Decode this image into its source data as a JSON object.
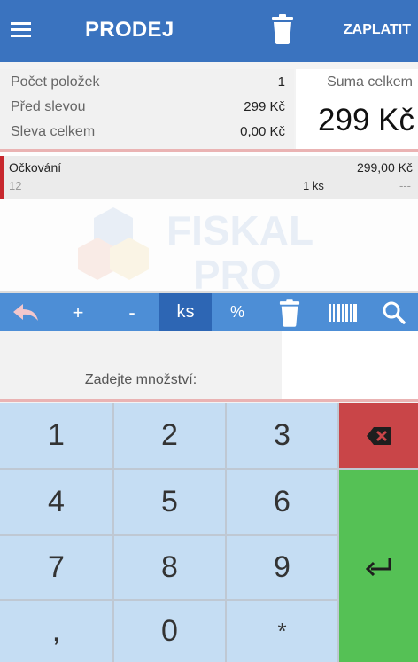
{
  "header": {
    "menu_icon": "hamburger-icon",
    "title": "PRODEJ",
    "delete_icon": "trash-icon",
    "pay_label": "ZAPLATIT"
  },
  "summary": {
    "items_count_label": "Počet položek",
    "items_count_value": "1",
    "before_discount_label": "Před slevou",
    "before_discount_value": "299 Kč",
    "discount_total_label": "Sleva celkem",
    "discount_total_value": "0,00 Kč",
    "total_label": "Suma celkem",
    "total_value": "299 Kč"
  },
  "items": [
    {
      "name": "Očkování",
      "price": "299,00 Kč",
      "code": "12",
      "qty": "1 ks",
      "discount": "---"
    }
  ],
  "watermark": {
    "line1": "FISKAL",
    "line2": "PRO"
  },
  "toolbar": {
    "back_icon": "reply-arrow-icon",
    "plus": "+",
    "minus": "-",
    "unit": "ks",
    "percent": "%",
    "delete_icon": "trash-icon",
    "barcode_icon": "barcode-icon",
    "search_icon": "search-icon"
  },
  "entry": {
    "label": "Zadejte množství:",
    "value": ""
  },
  "keypad": {
    "keys": [
      "1",
      "2",
      "3",
      "4",
      "5",
      "6",
      "7",
      "8",
      "9",
      ",",
      "0",
      "*"
    ],
    "backspace_icon": "backspace-icon",
    "enter_icon": "enter-icon"
  },
  "colors": {
    "header": "#3a73bf",
    "toolbar": "#4d8ed6",
    "toolbar_active": "#2d66b4",
    "key": "#c5ddf3",
    "backspace": "#c94548",
    "enter": "#55c155",
    "item_marker": "#c7272d"
  }
}
